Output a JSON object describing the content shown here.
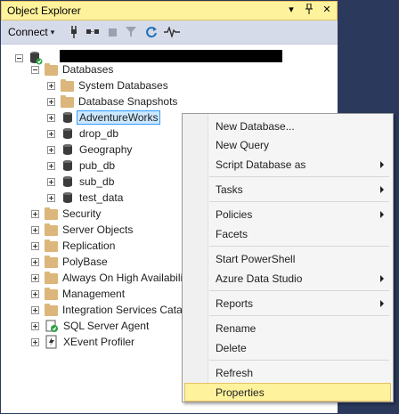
{
  "panel": {
    "title": "Object Explorer",
    "title_buttons": [
      "▾",
      " ⊓ ",
      "✕"
    ],
    "pin_glyph": "ᛧ",
    "accent_color": "#fff29d",
    "background_color": "#2b3a5c"
  },
  "toolbar": {
    "connect_label": "Connect",
    "connect_arrow": "▾",
    "icons": [
      "connect-plug-icon",
      "disconnect-icon",
      "stop-icon",
      "filter-icon",
      "refresh-icon",
      "activity-monitor-icon"
    ]
  },
  "tree": {
    "databases": "Databases",
    "system_databases": "System Databases",
    "database_snapshots": "Database Snapshots",
    "db_items": [
      "AdventureWorks",
      "drop_db",
      "Geography",
      "pub_db",
      "sub_db",
      "test_data"
    ],
    "folders": [
      "Security",
      "Server Objects",
      "Replication",
      "PolyBase",
      "Always On High Availabili",
      "Management",
      "Integration Services Catalo"
    ],
    "agent": "SQL Server Agent",
    "xevent": "XEvent Profiler"
  },
  "context_menu": {
    "items": [
      "New Database...",
      "New Query",
      "Script Database as",
      "Tasks",
      "Policies",
      "Facets",
      "Start PowerShell",
      "Azure Data Studio",
      "Reports",
      "Rename",
      "Delete",
      "Refresh",
      "Properties"
    ],
    "highlighted": "Properties"
  }
}
